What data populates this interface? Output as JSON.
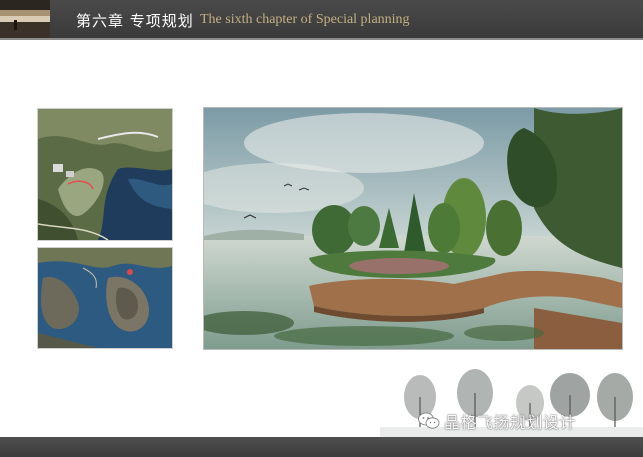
{
  "header": {
    "title_cn": "第六章 专项规划",
    "title_en": "The sixth chapter of Special planning",
    "thumbnail_icon": "landscape-thumbnail"
  },
  "content": {
    "aerial_map_top_icon": "aerial-map-image",
    "aerial_map_bottom_icon": "aerial-satellite-image",
    "rendering_icon": "waterfront-park-rendering"
  },
  "watermark": {
    "icon": "wechat-icon",
    "text": "晶格飞扬规划设计"
  },
  "colors": {
    "header_bg": "#3d3d3d",
    "title_cn": "#ffffff",
    "title_en": "#c4b183",
    "footer_bg": "#444444"
  }
}
